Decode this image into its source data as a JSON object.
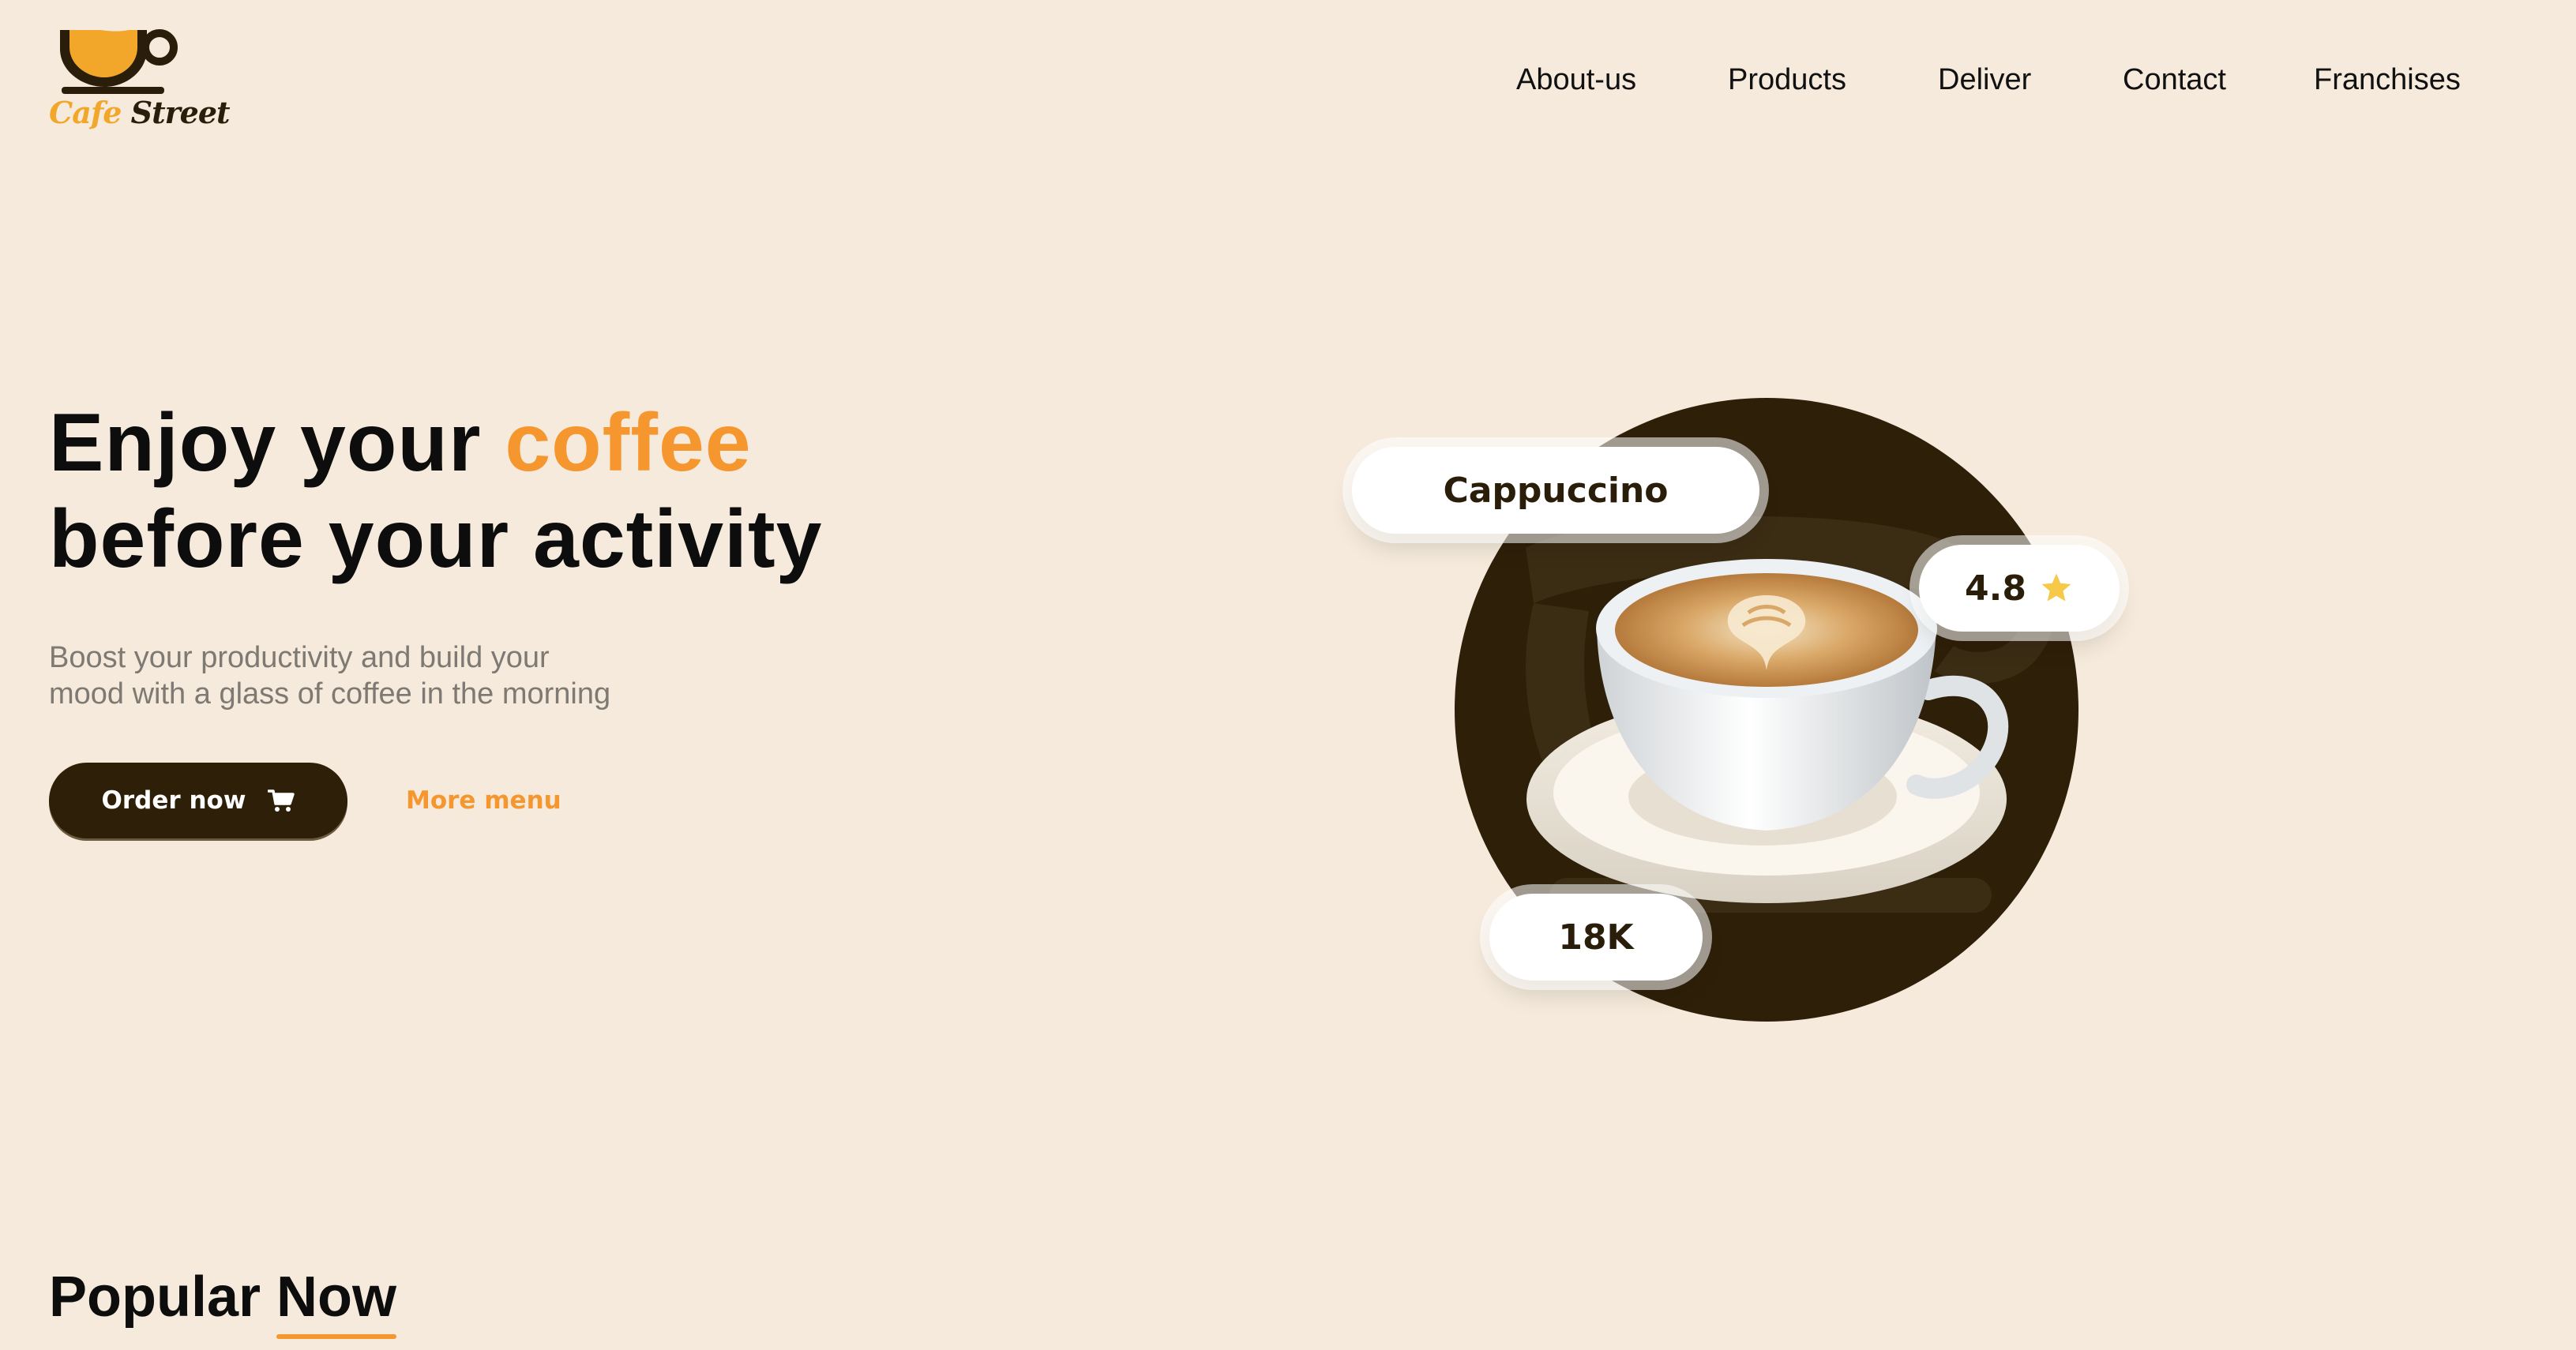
{
  "brand": {
    "word1": "Cafe",
    "word2": "Street"
  },
  "nav": {
    "items": [
      {
        "label": "About-us"
      },
      {
        "label": "Products"
      },
      {
        "label": "Deliver"
      },
      {
        "label": "Contact"
      },
      {
        "label": "Franchises"
      }
    ]
  },
  "hero": {
    "title_part1": "Enjoy your ",
    "title_accent": "coffee",
    "title_line2": "before your activity",
    "subtitle_line1": "Boost your productivity and build your",
    "subtitle_line2": "mood with a glass of coffee in the morning",
    "order_button": "Order now",
    "order_icon": "cart-icon",
    "more_menu": "More menu"
  },
  "featured": {
    "name": "Cappuccino",
    "rating": "4.8",
    "rating_icon": "star-icon",
    "count": "18K"
  },
  "popular": {
    "word1": "Popular",
    "word2": "Now"
  },
  "colors": {
    "background": "#f5eadb",
    "accent": "#f6962e",
    "dark": "#2e1f08",
    "logo_yellow": "#f2a72a",
    "star": "#f7c948"
  }
}
